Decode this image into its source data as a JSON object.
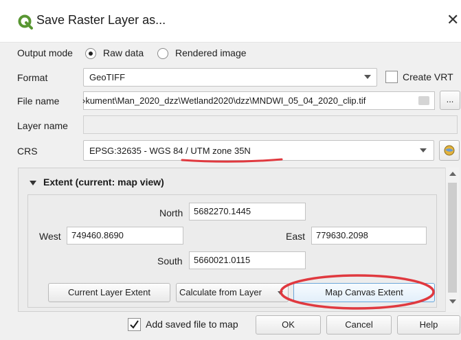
{
  "window": {
    "title": "Save Raster Layer as...",
    "close_glyph": "✕"
  },
  "output_mode": {
    "label": "Output mode",
    "options": [
      {
        "label": "Raw data",
        "checked": true
      },
      {
        "label": "Rendered image",
        "checked": false
      }
    ]
  },
  "format": {
    "label": "Format",
    "value": "GeoTIFF",
    "create_vrt_label": "Create VRT",
    "create_vrt_checked": false
  },
  "file_name": {
    "label": "File name",
    "value": "›kument\\Man_2020_dzz\\Wetland2020\\dzz\\MNDWI_05_04_2020_clip.tif",
    "browse_label": "..."
  },
  "layer_name": {
    "label": "Layer name",
    "value": ""
  },
  "crs": {
    "label": "CRS",
    "value": "EPSG:32635 - WGS 84 / UTM zone 35N"
  },
  "extent": {
    "header": "Extent (current: map view)",
    "north_label": "North",
    "north": "5682270.1445",
    "west_label": "West",
    "west": "749460.8690",
    "east_label": "East",
    "east": "779630.2098",
    "south_label": "South",
    "south": "5660021.0115",
    "buttons": {
      "current_layer": "Current Layer Extent",
      "calculate_from_layer": "Calculate from Layer",
      "map_canvas": "Map Canvas Extent"
    }
  },
  "footer": {
    "add_to_map_label": "Add saved file to map",
    "add_to_map_checked": true,
    "ok": "OK",
    "cancel": "Cancel",
    "help": "Help"
  },
  "colors": {
    "annotation_red": "#e0393f",
    "qgis_green": "#589632"
  }
}
